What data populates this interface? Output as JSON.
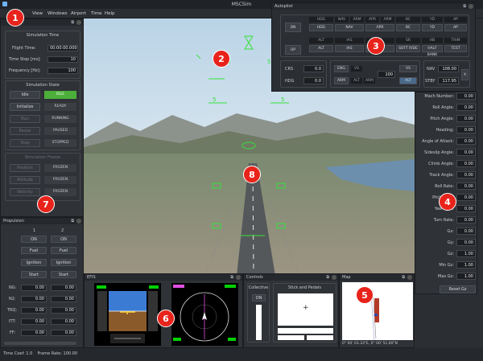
{
  "window": {
    "title": "MSCSim"
  },
  "menu": {
    "items": [
      "View",
      "Windows",
      "Airport",
      "Time",
      "Help"
    ]
  },
  "sim": {
    "group_time": "Simulation Time",
    "flight_time_label": "Flight Time:",
    "flight_time": "00:00:00.000",
    "time_step_label": "Time Step [ms]:",
    "time_step": "10",
    "frequency_label": "Frequency [Hz]:",
    "frequency": "100",
    "group_state": "Simulation State",
    "idle_btn": "Idle",
    "idle_status": "IDLE",
    "init_btn": "Initialize",
    "init_status": "READY",
    "run_btn": "Run",
    "run_status": "RUNNING",
    "pause_btn": "Pause",
    "pause_status": "PAUSED",
    "stop_btn": "Stop",
    "stop_status": "STOPPED",
    "group_freeze": "Simulation Freeze",
    "pos_btn": "Position",
    "pos_status": "FROZEN",
    "att_btn": "Attitude",
    "att_status": "FROZEN",
    "vel_btn": "Velocity",
    "vel_status": "FROZEN"
  },
  "propulsion": {
    "title": "Propulsion",
    "col1": "1",
    "col2": "2",
    "on": "ON",
    "fuel": "Fuel",
    "ignition": "Ignition",
    "start": "Start",
    "rows": [
      {
        "label": "NG:",
        "v1": "0.00",
        "v2": "0.00"
      },
      {
        "label": "N2:",
        "v1": "0.00",
        "v2": "0.00"
      },
      {
        "label": "TRQ:",
        "v1": "0.00",
        "v2": "0.00"
      },
      {
        "label": "ITT:",
        "v1": "0.00",
        "v2": "0.00"
      },
      {
        "label": "FF:",
        "v1": "0.00",
        "v2": "0.00"
      }
    ]
  },
  "autopilot": {
    "title": "Autopilot",
    "dn": "DN",
    "up": "UP",
    "top_labels": [
      "HDG",
      "NAV",
      "ARM",
      "APR",
      "ARM",
      "BC",
      "YD",
      "AP"
    ],
    "row1": [
      "HDG",
      "NAV",
      "APR",
      "BC",
      "YD",
      "AP"
    ],
    "mid_labels": [
      "ALT",
      "IAS",
      "VS",
      "SR",
      "HB",
      "TRIM"
    ],
    "row2": [
      "ALT",
      "IAS",
      "VS",
      "SOFT RIDE",
      "HALF BANK",
      "TEST"
    ],
    "crs_label": "CRS",
    "crs_val": "0.0",
    "hdg_label": "HDG",
    "hdg_val": "0.0",
    "eng": "ENG",
    "arm": "ARM",
    "vs_lbl": "VS",
    "alt_lbl": "ALT",
    "arm2": "ARM",
    "vs_val": "100",
    "vs_btn": "VS",
    "alt_btn": "ALT",
    "nav_label": "NAV",
    "nav_val": "108.00",
    "stby_label": "STBY",
    "stby_val": "117.95",
    "swap": "X"
  },
  "data": {
    "rows": [
      {
        "label": "Mach Number:",
        "value": "0.00"
      },
      {
        "label": "Roll Angle:",
        "value": "0.00"
      },
      {
        "label": "Pitch Angle:",
        "value": "0.00"
      },
      {
        "label": "Heading:",
        "value": "0.00"
      },
      {
        "label": "Angle of Attack:",
        "value": "0.00"
      },
      {
        "label": "Sideslip Angle:",
        "value": "0.00"
      },
      {
        "label": "Climb Angle:",
        "value": "0.00"
      },
      {
        "label": "Track Angle:",
        "value": "0.00"
      },
      {
        "label": "Roll Rate:",
        "value": "0.00"
      },
      {
        "label": "Pitch Rate:",
        "value": "0.00"
      },
      {
        "label": "Yaw Rate:",
        "value": "0.00"
      },
      {
        "label": "Turn Rate:",
        "value": "0.00"
      },
      {
        "label": "Gx:",
        "value": "0.00"
      },
      {
        "label": "Gy:",
        "value": "0.00"
      },
      {
        "label": "Gz:",
        "value": "1.00"
      },
      {
        "label": "Min Gz:",
        "value": "1.00"
      },
      {
        "label": "Max Gz:",
        "value": "1.00"
      }
    ],
    "reset": "Reset Gz"
  },
  "efis": {
    "title": "EFIS"
  },
  "controls": {
    "title": "Controls",
    "collective": "Collective",
    "on": "ON",
    "stick": "Stick and Pedals"
  },
  "map": {
    "title": "Map",
    "coords": "0° 00' 03.33\"E, 0° 00' 51.00\"N"
  },
  "status": {
    "text": "Time Coef: 1.0    Frame Rate: 100.00"
  },
  "hud": {
    "five_a": "5",
    "five_b": "5",
    "five_c": "5",
    "five_d": "5"
  },
  "badges": [
    "1",
    "2",
    "3",
    "4",
    "5",
    "6",
    "7",
    "8"
  ],
  "colors": {
    "accent_green": "#4caf3a",
    "hud_green": "#35e23a",
    "badge_red": "#e8231b"
  }
}
